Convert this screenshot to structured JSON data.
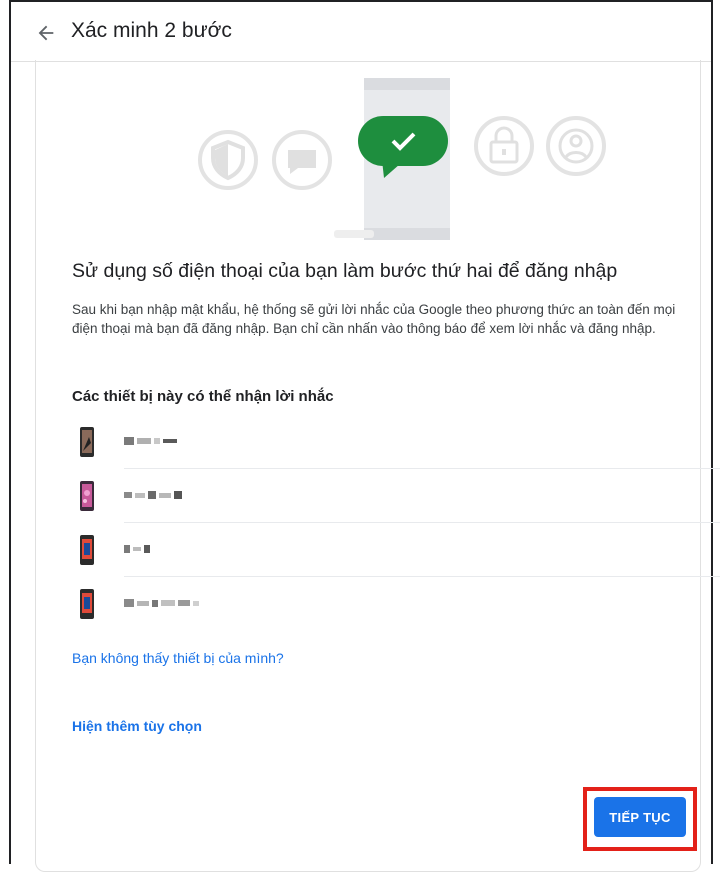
{
  "header": {
    "title": "Xác minh 2 bước",
    "back_icon": "arrow-left-icon"
  },
  "illustration": {
    "icons": [
      "shield-icon",
      "chat-bubble-icon",
      "checkmark-message-icon",
      "lock-icon",
      "person-circle-icon"
    ],
    "accent_color": "#1e8e3e"
  },
  "main": {
    "headline": "Sử dụng số điện thoại của bạn làm bước thứ hai để đăng nhập",
    "description": "Sau khi bạn nhập mật khẩu, hệ thống sẽ gửi lời nhắc của Google theo phương thức an toàn đến mọi điện thoại mà bạn đã đăng nhập. Bạn chỉ cần nhấn vào thông báo để xem lời nhắc và đăng nhập.",
    "devices_heading": "Các thiết bị này có thể nhận lời nhắc"
  },
  "devices": [
    {
      "name": "",
      "icon": "phone-icon"
    },
    {
      "name": "",
      "icon": "phone-icon"
    },
    {
      "name": "",
      "icon": "phone-icon"
    },
    {
      "name": "",
      "icon": "phone-icon"
    }
  ],
  "links": {
    "missing_device": "Bạn không thấy thiết bị của mình?",
    "more_options": "Hiện thêm tùy chọn"
  },
  "actions": {
    "continue_label": "TIẾP TỤC"
  },
  "colors": {
    "primary": "#1a73e8",
    "highlight": "#e32119"
  }
}
